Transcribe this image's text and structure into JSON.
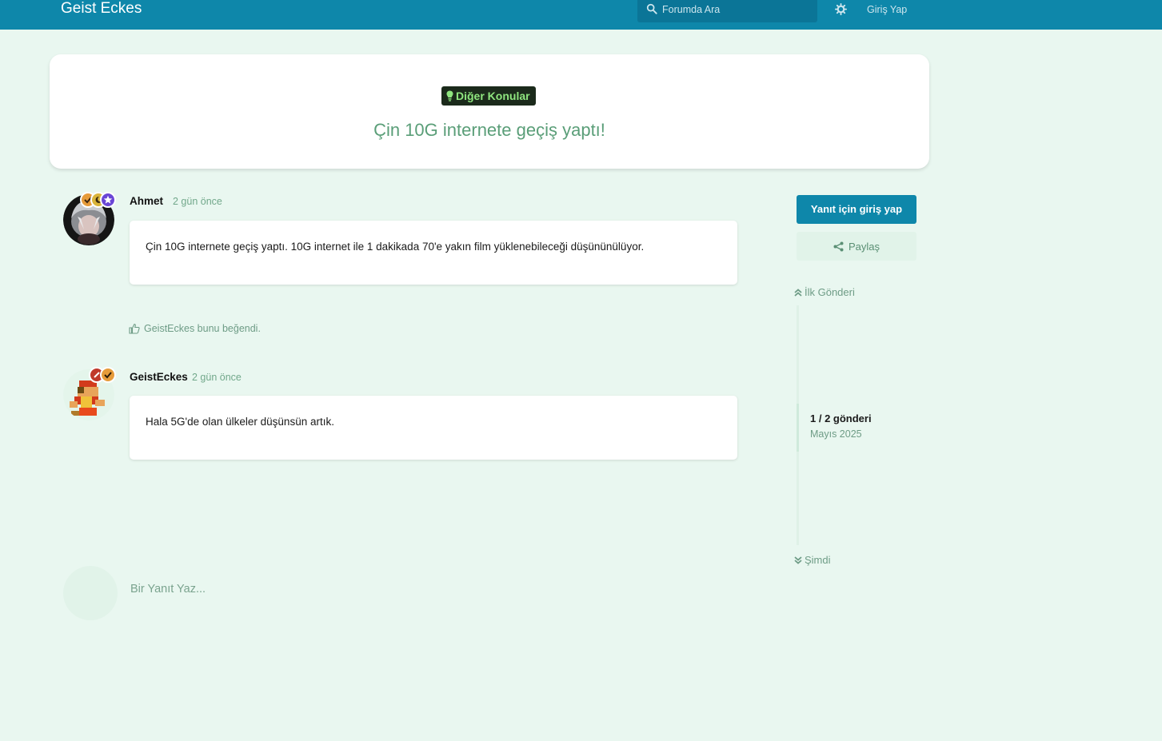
{
  "header": {
    "brand": "Geist Eckes",
    "search_placeholder": "Forumda Ara",
    "login": "Giriş Yap"
  },
  "discussion": {
    "tag": "Diğer Konular",
    "title": "Çin 10G internete geçiş yaptı!"
  },
  "posts": [
    {
      "author": "Ahmet",
      "time": "2 gün önce",
      "content": "Çin 10G internete geçiş yaptı. 10G internet ile 1 dakikada 70'e yakın film yüklenebileceği düşününülüyor.",
      "likes": "GeistEckes bunu beğendi."
    },
    {
      "author": "GeistEckes",
      "time": "2 gün önce",
      "content": "Hala 5G'de olan ülkeler düşünsün artık."
    }
  ],
  "sidebar": {
    "reply_button": "Yanıt için giriş yap",
    "share_button": "Paylaş",
    "first_post": "İlk Gönderi",
    "post_count": "1 / 2 gönderi",
    "date": "Mayıs 2025",
    "now": "Şimdi"
  },
  "composer": {
    "placeholder": "Bir Yanıt Yaz..."
  },
  "colors": {
    "header": "#0e87aa",
    "background": "#e9f7f0",
    "tag_background": "#1b2a1b",
    "tag_text": "#8fe67f"
  }
}
